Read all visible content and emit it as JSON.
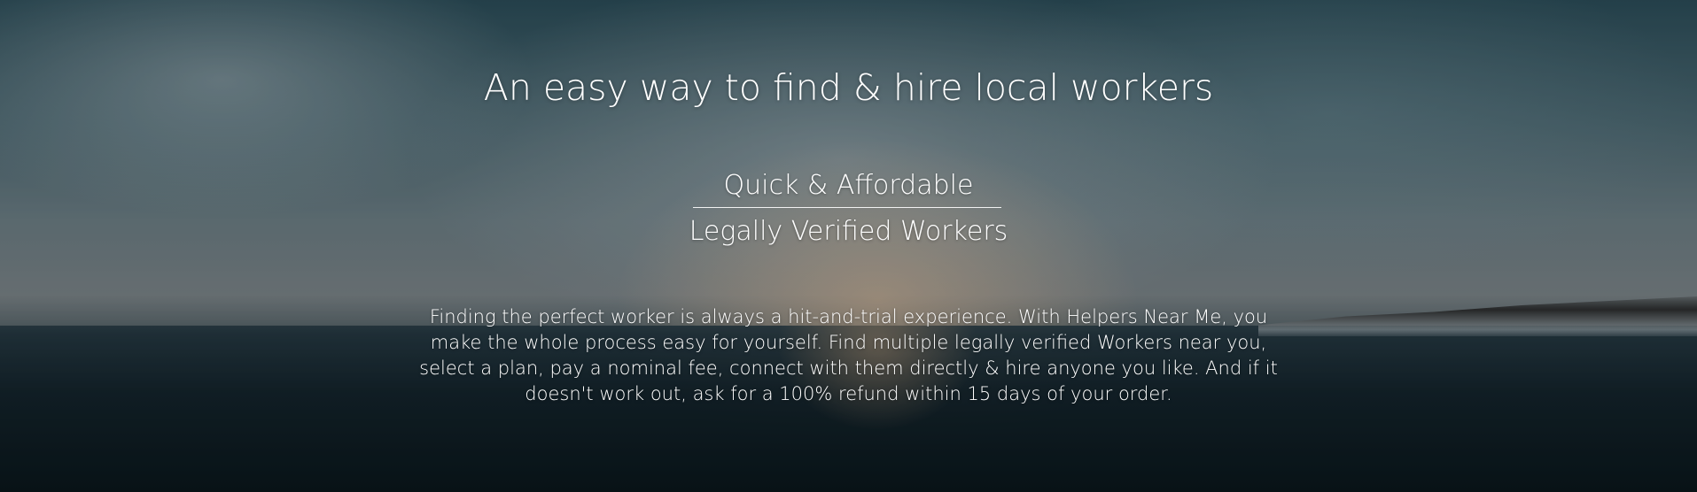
{
  "hero": {
    "headline": "An easy way to find & hire local workers",
    "features": [
      "Quick & Affordable",
      "Legally Verified Workers"
    ],
    "description": "Finding the perfect worker is always a hit-and-trial experience. With Helpers Near Me, you make the whole process easy for yourself. Find multiple legally verified Workers near you, select a plan, pay a nominal fee, connect with them directly & hire anyone you like. And if it doesn't work out, ask for a 100% refund within 15 days of your order."
  },
  "colors": {
    "text": "#ffffff",
    "sky": "#4d6a74",
    "sea": "#0d1b21",
    "sunset_glow": "#e6be96"
  }
}
